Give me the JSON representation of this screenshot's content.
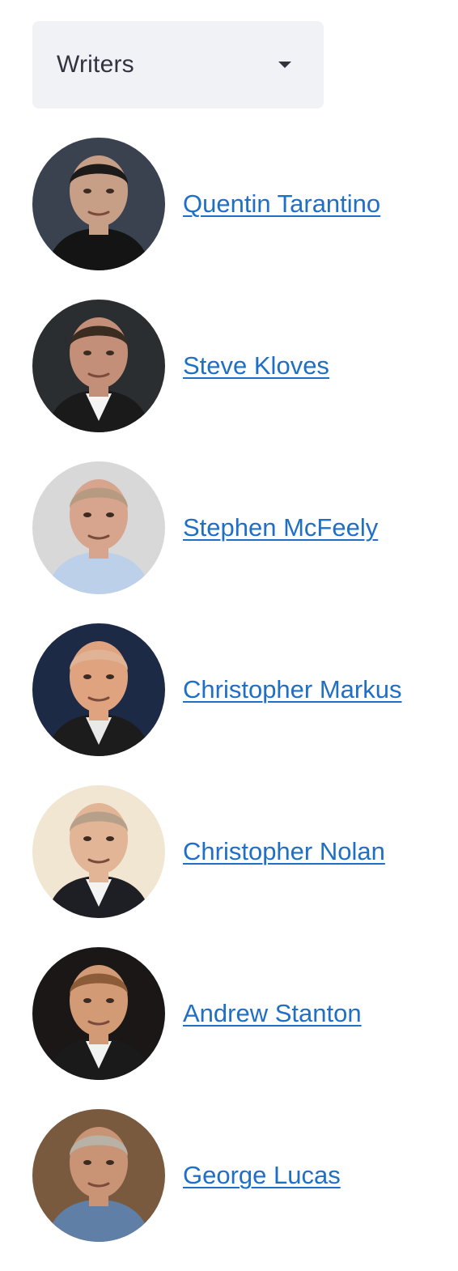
{
  "dropdown": {
    "selected": "Writers"
  },
  "people": [
    {
      "name": "Quentin Tarantino",
      "colors": {
        "bg": "#3a4250",
        "skin": "#c79e86",
        "hair": "#1d1a1a",
        "clothes": "#141414",
        "shirt": "#141414"
      }
    },
    {
      "name": "Steve Kloves",
      "colors": {
        "bg": "#2a2e30",
        "skin": "#c48f78",
        "hair": "#3b2c22",
        "clothes": "#1a1a1a",
        "shirt": "#f4f4f4"
      }
    },
    {
      "name": "Stephen McFeely",
      "colors": {
        "bg": "#d8d8d8",
        "skin": "#d7a58d",
        "hair": "#b69a82",
        "clothes": "#bcd0ea",
        "shirt": "#bcd0ea"
      }
    },
    {
      "name": "Christopher Markus",
      "colors": {
        "bg": "#1d2a45",
        "skin": "#e0a37f",
        "hair": "#e0b397",
        "clothes": "#1c1c1c",
        "shirt": "#e9e9e9"
      }
    },
    {
      "name": "Christopher Nolan",
      "colors": {
        "bg": "#f1e6d1",
        "skin": "#e2b597",
        "hair": "#b7a08a",
        "clothes": "#1e1f24",
        "shirt": "#f3f3f3"
      }
    },
    {
      "name": "Andrew Stanton",
      "colors": {
        "bg": "#1b1717",
        "skin": "#d39a76",
        "hair": "#8c5c38",
        "clothes": "#1a1a1a",
        "shirt": "#f2f2f2"
      }
    },
    {
      "name": "George Lucas",
      "colors": {
        "bg": "#7a5a3e",
        "skin": "#c99475",
        "hair": "#b7b1a6",
        "clothes": "#5f7fa6",
        "shirt": "#5f7fa6"
      }
    }
  ]
}
